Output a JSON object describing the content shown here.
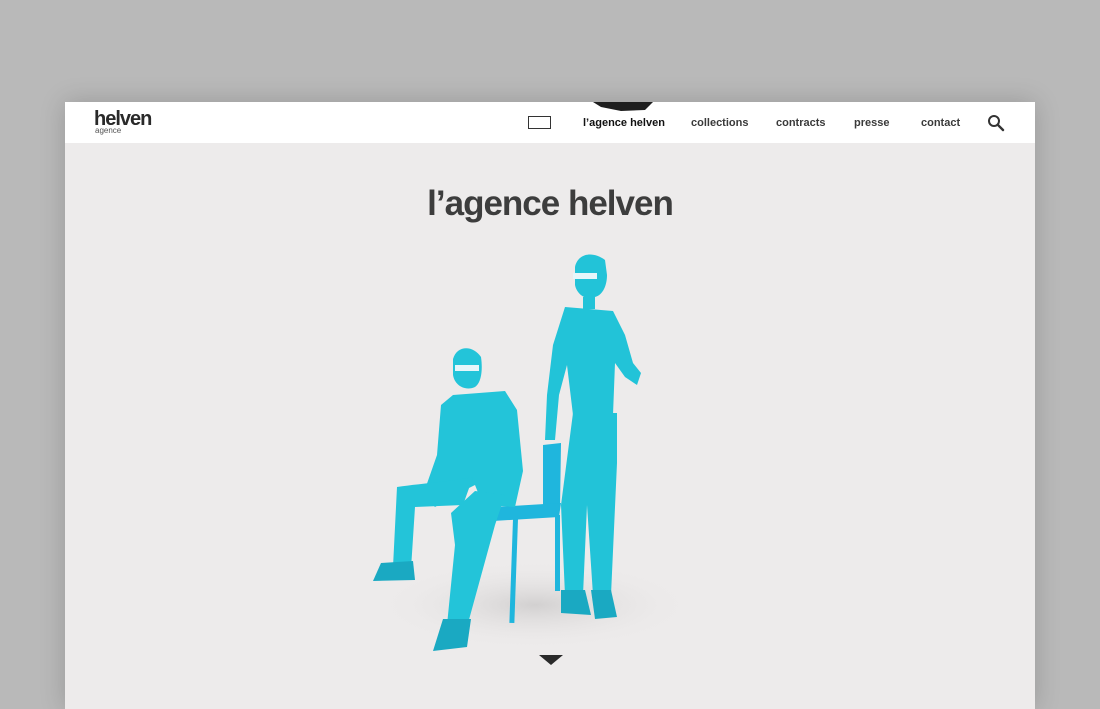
{
  "site": {
    "logo_main": "helven",
    "logo_sub": "agence"
  },
  "nav": {
    "items": [
      {
        "label": "l’agence helven",
        "active": true
      },
      {
        "label": "collections",
        "active": false
      },
      {
        "label": "contracts",
        "active": false
      },
      {
        "label": "presse",
        "active": false
      },
      {
        "label": "contact",
        "active": false
      }
    ]
  },
  "icons": {
    "menu": "menu-box-icon",
    "search": "search-icon",
    "scroll_down": "triangle-down-icon"
  },
  "page": {
    "title": "l’agence helven"
  },
  "colors": {
    "outer_bg": "#b9b9b9",
    "page_bg": "#edebeb",
    "header_bg": "#ffffff",
    "title": "#3d3d3d",
    "photo_tint": "#22c3d8"
  }
}
